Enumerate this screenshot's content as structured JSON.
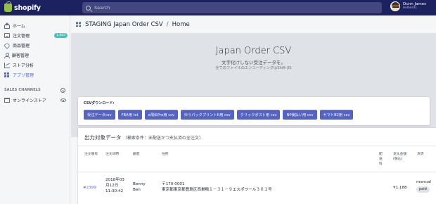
{
  "topbar": {
    "logo_text": "shopify",
    "search_placeholder": "Search",
    "user_name": "Dunn James",
    "user_store": "ledherd1"
  },
  "sidebar": {
    "items": [
      {
        "label": "ホーム",
        "icon": "home-icon"
      },
      {
        "label": "注文管理",
        "icon": "orders-icon",
        "badge": "1,983"
      },
      {
        "label": "商品管理",
        "icon": "tag-icon"
      },
      {
        "label": "顧客管理",
        "icon": "customers-icon"
      },
      {
        "label": "ストア分析",
        "icon": "analytics-icon"
      },
      {
        "label": "アプリ管理",
        "icon": "apps-icon",
        "active": true
      }
    ],
    "sales_channels_title": "SALES CHANNELS",
    "online_store_label": "オンラインストア"
  },
  "header": {
    "app_name": "STAGING Japan Order CSV",
    "separator": "/",
    "page": "Home"
  },
  "hero": {
    "title": "Japan Order CSV",
    "subtitle": "文字化けしない受注データを。",
    "note": "全てのファイルのエンコーディングはShift-JIS"
  },
  "csv": {
    "label": "CSVダウンロード:",
    "buttons": [
      "受注データcsv",
      "FBA用 txt",
      "e飛伝Pro用 csv",
      "ゆうパックプリントR用 csv",
      "クリックポスト用 csv",
      "NP後払い用 csv",
      "ヤマトB2用 csv"
    ]
  },
  "orders": {
    "title": "出力対象データ",
    "condition": "（検索条件：未配送かつ支払済の全注文）",
    "headers": {
      "order_no": "注文番号",
      "date": "注文日時",
      "customer": "顧客",
      "address": "住所",
      "delivery": "配送料",
      "amount": "支払金額(税込)",
      "payment": "決済"
    },
    "rows": [
      {
        "order_no": "#2399",
        "date": "2018年03月12日 11:30:42",
        "customer": "Benny Ben",
        "postal": "〒170-0001",
        "address": "東京都東京都豊島区西巣鴨１－３１－９エスポワール３０１号",
        "delivery": "",
        "amount": "¥1,188",
        "payment_method": "manual",
        "payment_status": "paid"
      }
    ]
  },
  "colors": {
    "topbar": "#1c2260",
    "accent": "#5c6ac4",
    "button": "#5563c1",
    "badge": "#47c1bf"
  }
}
